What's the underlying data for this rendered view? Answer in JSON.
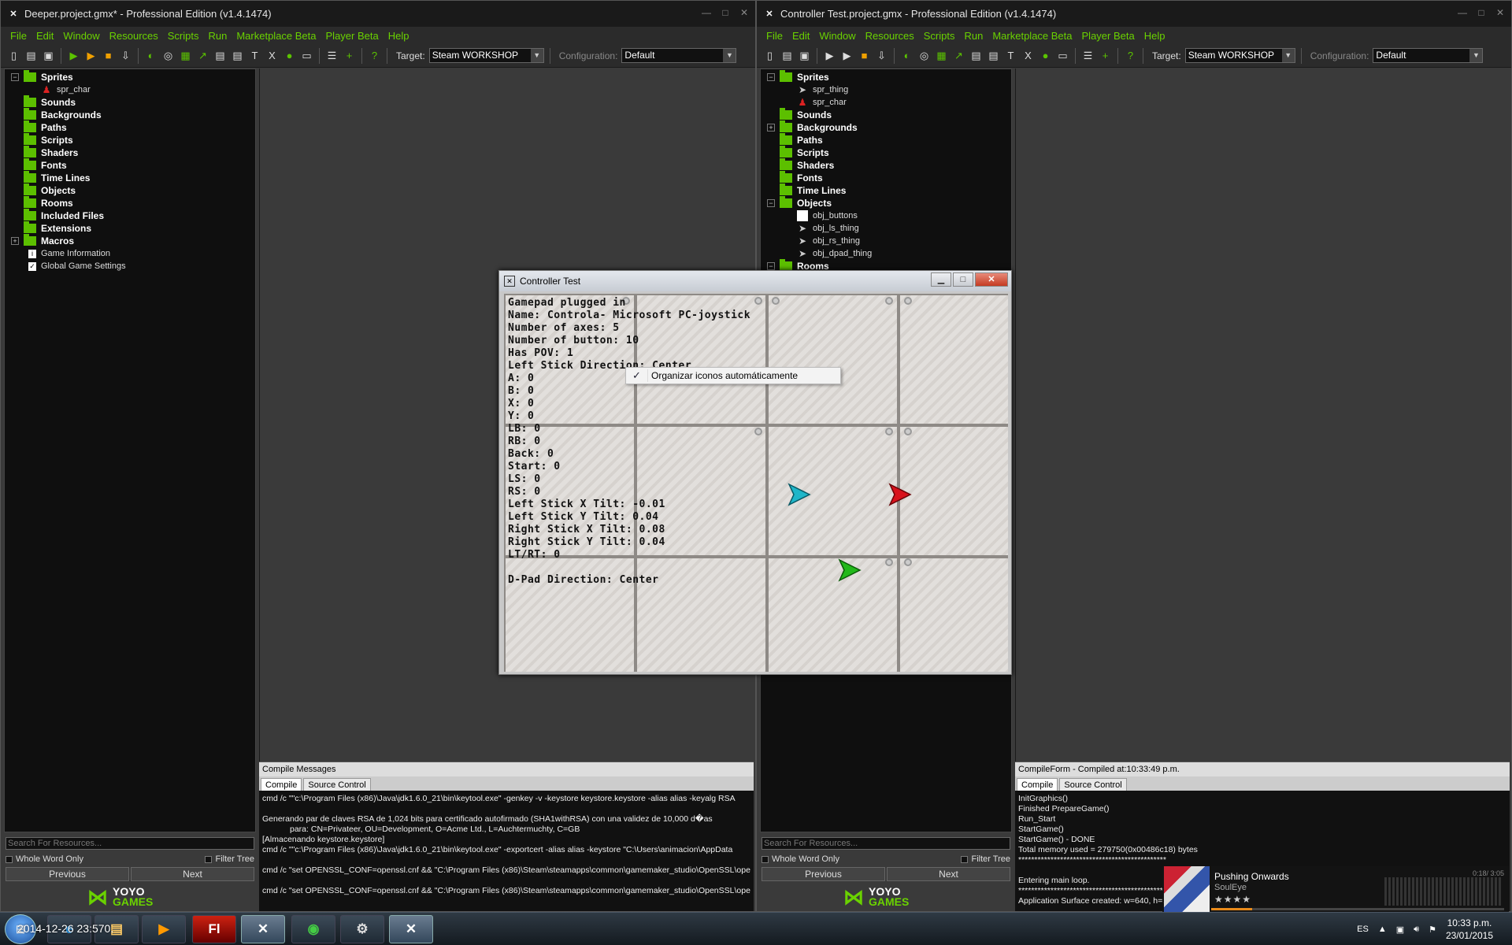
{
  "left_ide": {
    "title": "Deeper.project.gmx*  -  Professional Edition (v1.4.1474)",
    "menu": [
      "File",
      "Edit",
      "Window",
      "Resources",
      "Scripts",
      "Run",
      "Marketplace Beta",
      "Player Beta",
      "Help"
    ],
    "target_label": "Target:",
    "target_value": "Steam WORKSHOP",
    "config_label": "Configuration:",
    "config_value": "Default",
    "tree": [
      {
        "label": "Sprites",
        "expanded": true,
        "children": [
          "spr_char"
        ]
      },
      {
        "label": "Sounds"
      },
      {
        "label": "Backgrounds"
      },
      {
        "label": "Paths"
      },
      {
        "label": "Scripts"
      },
      {
        "label": "Shaders"
      },
      {
        "label": "Fonts"
      },
      {
        "label": "Time Lines"
      },
      {
        "label": "Objects"
      },
      {
        "label": "Rooms"
      },
      {
        "label": "Included Files"
      },
      {
        "label": "Extensions"
      },
      {
        "label": "Macros",
        "collapsed": true
      }
    ],
    "leaves": [
      "Game Information",
      "Global Game Settings"
    ],
    "search_placeholder": "Search For Resources...",
    "whole_word": "Whole Word Only",
    "filter_tree": "Filter Tree",
    "previous": "Previous",
    "next": "Next",
    "compile_header": "Compile Messages",
    "tabs": [
      "Compile",
      "Source Control"
    ],
    "log": "cmd /c \"\"c:\\Program Files (x86)\\Java\\jdk1.6.0_21\\bin\\keytool.exe\" -genkey -v -keystore keystore.keystore -alias alias -keyalg RSA\n\nGenerando par de claves RSA de 1,024 bits para certificado autofirmado (SHA1withRSA) con una validez de 10,000 d�as\n            para: CN=Privateer, OU=Development, O=Acme Ltd., L=Auchtermuchty, C=GB\n[Almacenando keystore.keystore]\ncmd /c \"\"c:\\Program Files (x86)\\Java\\jdk1.6.0_21\\bin\\keytool.exe\" -exportcert -alias alias -keystore \"C:\\Users\\animacion\\AppData\n\ncmd /c \"set OPENSSL_CONF=openssl.cnf && \"C:\\Program Files (x86)\\Steam\\steamapps\\common\\gamemaker_studio\\OpenSSL\\ope\n\ncmd /c \"set OPENSSL_CONF=openssl.cnf && \"C:\\Program Files (x86)\\Steam\\steamapps\\common\\gamemaker_studio\\OpenSSL\\ope"
  },
  "right_ide": {
    "title": "Controller Test.project.gmx  -  Professional Edition (v1.4.1474)",
    "menu": [
      "File",
      "Edit",
      "Window",
      "Resources",
      "Scripts",
      "Run",
      "Marketplace Beta",
      "Player Beta",
      "Help"
    ],
    "target_label": "Target:",
    "target_value": "Steam WORKSHOP",
    "config_label": "Configuration:",
    "config_value": "Default",
    "sprites": {
      "label": "Sprites",
      "children": [
        "spr_thing",
        "spr_char"
      ]
    },
    "mid": [
      "Sounds",
      "Backgrounds",
      "Paths",
      "Scripts",
      "Shaders",
      "Fonts",
      "Time Lines"
    ],
    "objects": {
      "label": "Objects",
      "children": [
        "obj_buttons",
        "obj_ls_thing",
        "obj_rs_thing",
        "obj_dpad_thing"
      ]
    },
    "rooms": "Rooms",
    "search_placeholder": "Search For Resources...",
    "whole_word": "Whole Word Only",
    "filter_tree": "Filter Tree",
    "previous": "Previous",
    "next": "Next",
    "compile_header": "CompileForm - Compiled at:10:33:49 p.m.",
    "tabs": [
      "Compile",
      "Source Control"
    ],
    "log": "InitGraphics()\nFinished PrepareGame()\nRun_Start\nStartGame()\nStartGame() - DONE\nTotal memory used = 279750(0x00486c18) bytes\n**********************************************\n\nEntering main loop.\n**********************************************\nApplication Surface created: w=640, h=..."
  },
  "game": {
    "title": "Controller Test",
    "hud": [
      "Gamepad plugged in",
      "Name: Controla- Microsoft PC-joystick",
      "Number of axes: 5",
      "Number of button: 10",
      "Has POV: 1",
      "Left Stick Direction: Center",
      "A: 0",
      "B: 0",
      "X: 0",
      "Y: 0",
      "LB: 0",
      "RB: 0",
      "Back: 0",
      "Start: 0",
      "LS: 0",
      "RS: 0",
      "Left Stick X Tilt: -0.01",
      "Left Stick Y Tilt: 0.04",
      "Right Stick X Tilt: 0.08",
      "Right Stick Y Tilt: 0.04",
      "LT/RT: 0",
      "",
      "D-Pad Direction: Center"
    ],
    "context_menu_item": "Organizar iconos automáticamente"
  },
  "taskbar": {
    "overlay": "2014-12-26 23:570.",
    "language": "ES",
    "time": "10:33 p.m.",
    "date": "23/01/2015"
  },
  "media": {
    "track": "Pushing Onwards",
    "artist": "SoulEye",
    "rating_text": "★★★★",
    "progress": 0.14,
    "time_text": "0:18/ 3:05"
  },
  "colors": {
    "menu_green": "#6ad200",
    "folder_green": "#5cbf00",
    "arrow_cyan": "#1fb6c9",
    "arrow_red": "#d8121c",
    "arrow_green": "#22b81a"
  }
}
